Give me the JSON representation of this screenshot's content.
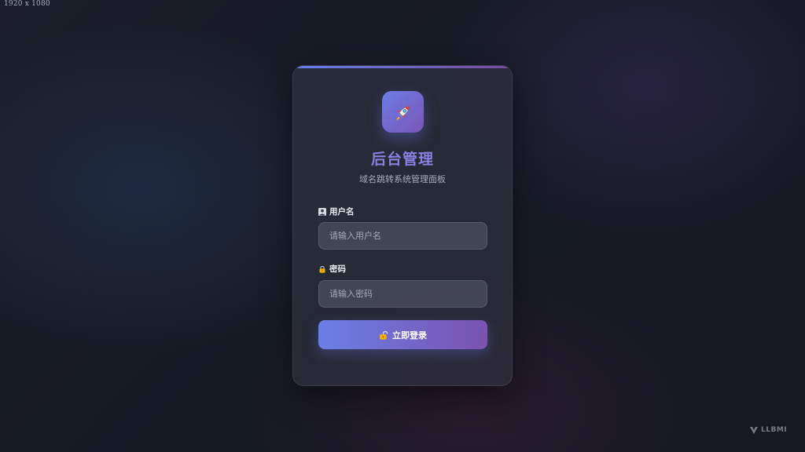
{
  "screen": {
    "dimension_label": "1920 x 1080"
  },
  "login": {
    "logo_icon": "rocket-icon",
    "title": "后台管理",
    "subtitle": "域名跳转系统管理面板",
    "username": {
      "icon": "user-icon",
      "label": "用户名",
      "placeholder": "请输入用户名",
      "value": ""
    },
    "password": {
      "icon": "lock-icon",
      "label": "密码",
      "placeholder": "请输入密码",
      "value": ""
    },
    "submit": {
      "icon": "unlock-icon",
      "label": "立即登录"
    }
  },
  "watermark": {
    "icon": "watermark-logo-icon",
    "text": "LLBMI"
  },
  "colors": {
    "accent_start": "#667eea",
    "accent_end": "#764ba2",
    "title": "#8b7fe0"
  }
}
